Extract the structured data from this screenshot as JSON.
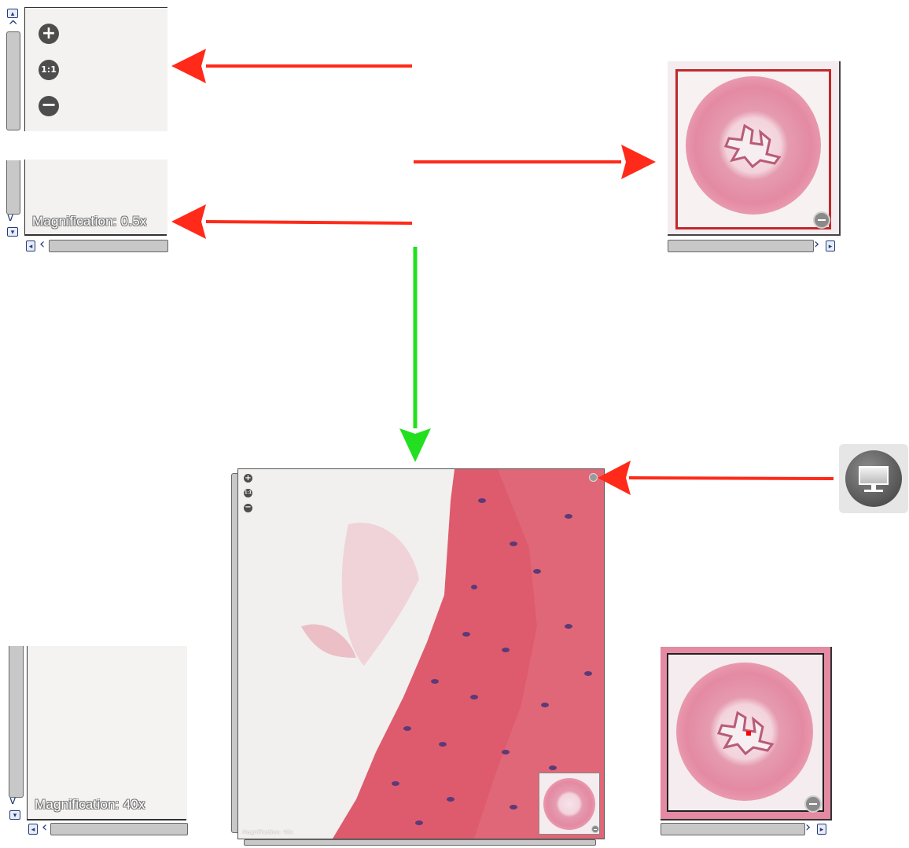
{
  "top_left_viewer": {
    "zoom_in_symbol": "+",
    "one_to_one_label": "1:1",
    "zoom_out_symbol": "−",
    "magnification_label": "Magnification: 0.5x"
  },
  "bottom_left_viewer": {
    "magnification_label": "Magnification: 40x"
  },
  "center_viewer": {
    "one_to_one_label": "1:1",
    "magnification_label": "Magnification: 40x"
  },
  "scroll_glyphs": {
    "left": "◂",
    "right": "▸",
    "up": "▴",
    "down": "▾",
    "chev_left": "‹",
    "chev_right": "›",
    "chev_up": "ˆ",
    "chev_down": "ˇ"
  },
  "icons": {
    "fullscreen": "monitor-icon"
  },
  "colors": {
    "arrow_red": "#ff2a1a",
    "arrow_green": "#22e01f",
    "scroll_blue": "#233c7a",
    "tissue_pink": "#e48aa3"
  }
}
